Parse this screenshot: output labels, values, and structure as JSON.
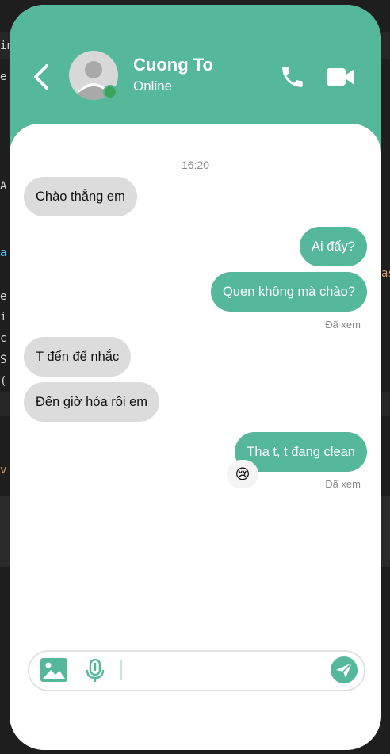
{
  "background_editor": {
    "fragments": [
      "in",
      "e",
      "A",
      "a",
      "e",
      "i",
      "c",
      "S",
      "(",
      "as",
      "v"
    ]
  },
  "header": {
    "contact_name": "Cuong To",
    "presence": "Online",
    "accent_color": "#55b89b",
    "online_color": "#3aa55a"
  },
  "conversation": {
    "timestamp": "16:20",
    "messages": [
      {
        "direction": "in",
        "text": "Chào thằng em"
      },
      {
        "direction": "out",
        "text": "Ai đấy?"
      },
      {
        "direction": "out",
        "text": "Quen không mà chào?"
      },
      {
        "direction": "in",
        "text": "T đến để nhắc"
      },
      {
        "direction": "in",
        "text": "Đến giờ hỏa rồi em"
      },
      {
        "direction": "out",
        "text": "Tha t, t đang clean"
      }
    ],
    "seen_label_1": "Đã xem",
    "seen_label_2": "Đã xem",
    "reaction_emoji": "😢"
  },
  "composer": {
    "input_value": "",
    "icons": [
      "image-icon",
      "microphone-icon",
      "send-icon"
    ]
  }
}
